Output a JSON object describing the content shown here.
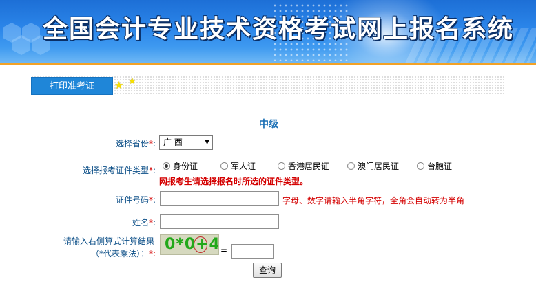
{
  "banner": {
    "title": "全国会计专业技术资格考试网上报名系统"
  },
  "tabs": {
    "active_label": "打印准考证"
  },
  "form": {
    "level_title": "中级",
    "required_mark": "*",
    "province": {
      "label": "选择省份",
      "colon": ":",
      "value": "广 西"
    },
    "id_type": {
      "label": "选择报考证件类型",
      "colon": ":",
      "options": [
        "身份证",
        "军人证",
        "香港居民证",
        "澳门居民证",
        "台胞证"
      ],
      "selected_index": 0,
      "warning": "网报考生请选择报名时所选的证件类型。"
    },
    "id_number": {
      "label": "证件号码",
      "colon": ":",
      "value": "",
      "hint": "字母、数字请输入半角字符，全角会自动转为半角"
    },
    "name": {
      "label": "姓名",
      "colon": ":",
      "value": ""
    },
    "captcha": {
      "label_line1": "请输入右侧算式计算结果",
      "label_line2": "（*代表乘法）：",
      "colon": ":",
      "image_text": "0*0+4",
      "equals": "=",
      "value": ""
    },
    "submit_label": "查询"
  },
  "colors": {
    "accent": "#1f86d8",
    "label": "#0b4e87",
    "warning": "#d40000",
    "banner_line": "#f2a227"
  }
}
